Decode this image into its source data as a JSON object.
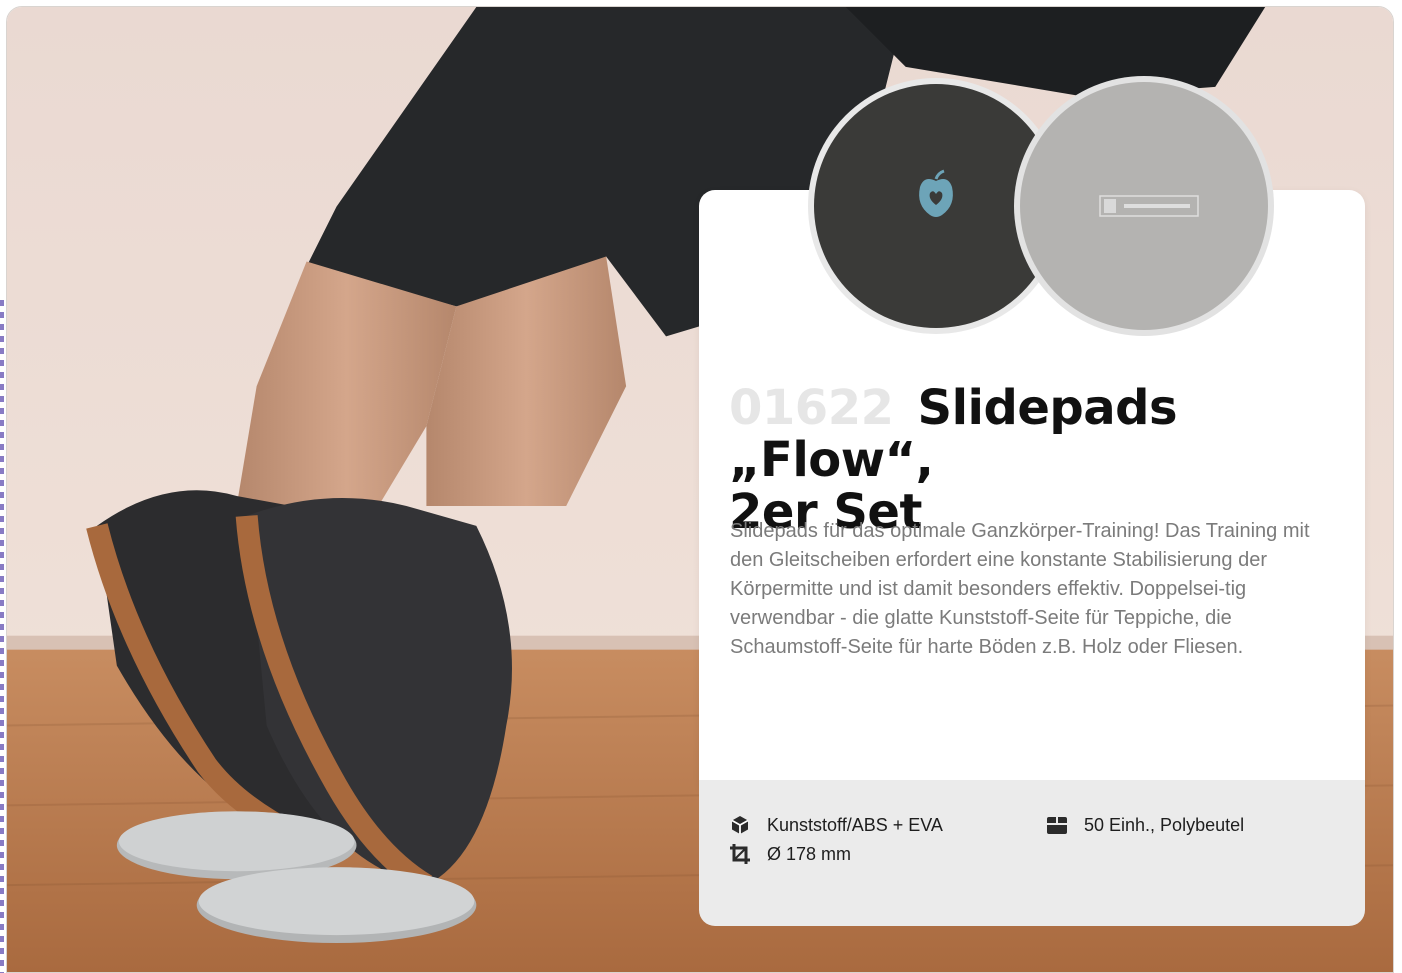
{
  "product": {
    "article_number": "01622",
    "title_line1": "Slidepads „Flow“,",
    "title_line2": "2er Set",
    "description": "Slidepads für das optimale Ganzkörper-Training! Das Training mit den Gleitscheiben erfordert eine konstante Stabilisierung der Körpermitte und ist damit besonders effektiv. Doppelsei-tig verwendbar - die glatte Kunststoff-Seite für Teppiche, die Schaumstoff-Seite für harte Böden z.B. Holz oder Fliesen."
  },
  "specs": {
    "material": "Kunststoff/ABS + EVA",
    "size": "Ø 178 mm",
    "packaging": "50 Einh., Polybeutel"
  },
  "icons": {
    "material": "cube-icon",
    "size": "crop-icon",
    "packaging": "box-icon"
  },
  "colors": {
    "card_background": "#ffffff",
    "footer_background": "#ebebeb",
    "title_text": "#111111",
    "article_number": "#e6e6e6",
    "body_text": "#7b7b7b"
  }
}
